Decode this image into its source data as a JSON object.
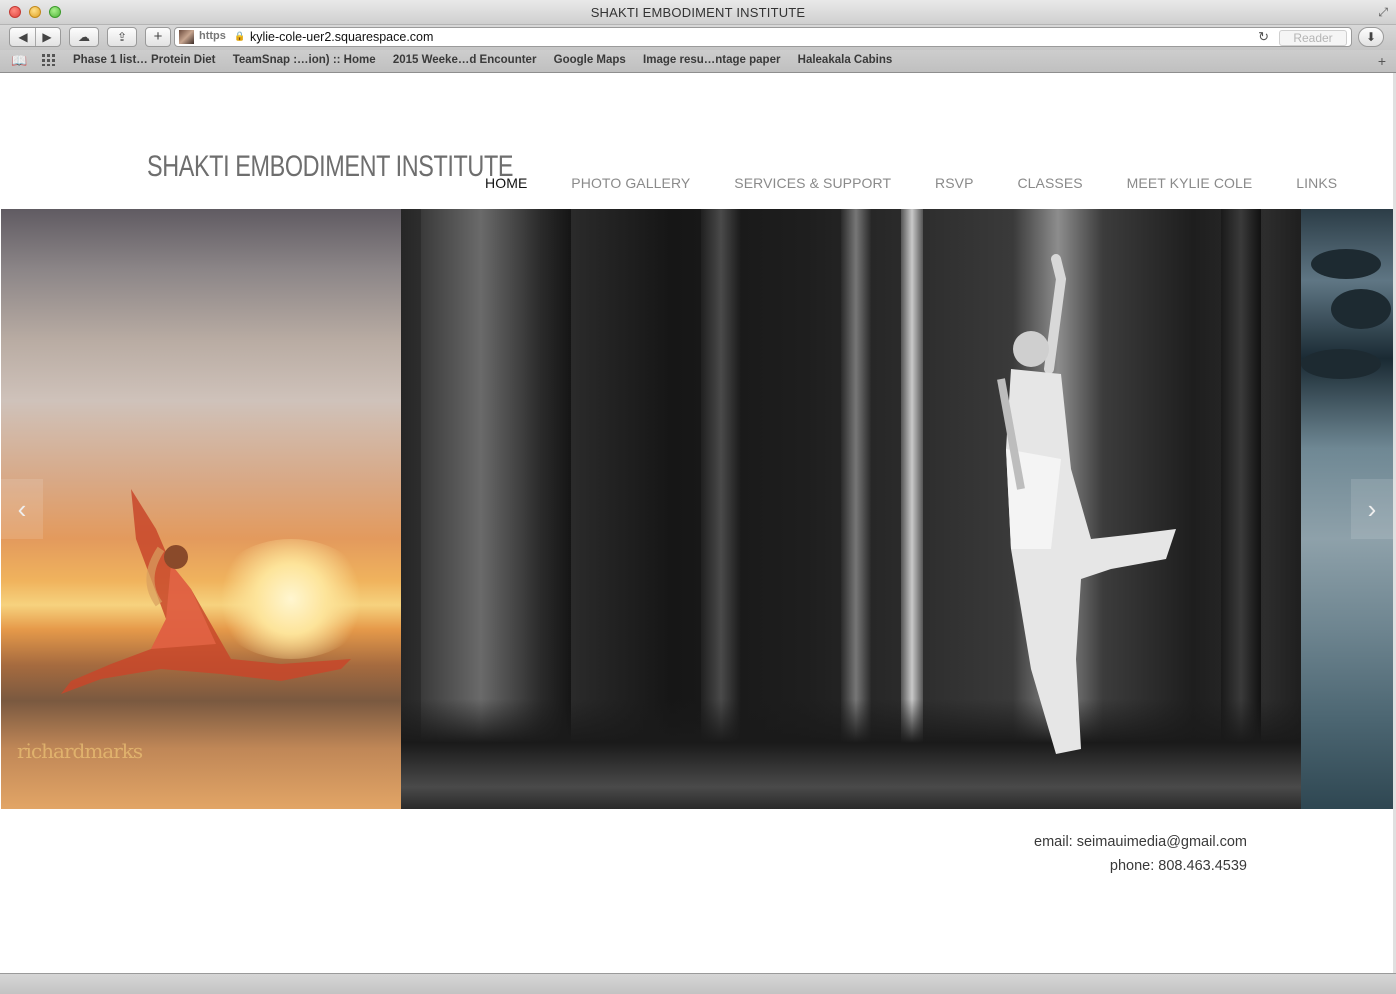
{
  "window": {
    "title": "SHAKTI EMBODIMENT INSTITUTE"
  },
  "toolbar": {
    "back_glyph": "◀",
    "forward_glyph": "▶",
    "icloud_glyph": "☁",
    "share_glyph": "⇪",
    "new_tab_glyph": "+",
    "url_scheme": "https",
    "url": "kylie-cole-uer2.squarespace.com",
    "reload_glyph": "↻",
    "reader_label": "Reader",
    "download_glyph": "⬇"
  },
  "bookmarks": {
    "items": [
      "Phase 1 list… Protein Diet",
      "TeamSnap :…ion) :: Home",
      "2015 Weeke…d Encounter",
      "Google Maps",
      "Image resu…ntage paper",
      "Haleakala Cabins"
    ],
    "add_glyph": "+"
  },
  "site": {
    "logo": "SHAKTI EMBODIMENT INSTITUTE",
    "nav": [
      {
        "label": "HOME",
        "active": true
      },
      {
        "label": "PHOTO GALLERY",
        "active": false
      },
      {
        "label": "SERVICES & SUPPORT",
        "active": false
      },
      {
        "label": "RSVP",
        "active": false
      },
      {
        "label": "CLASSES",
        "active": false
      },
      {
        "label": "MEET KYLIE COLE",
        "active": false
      },
      {
        "label": "LINKS",
        "active": false
      }
    ],
    "slideshow": {
      "prev_glyph": "‹",
      "next_glyph": "›",
      "watermark": "richardmarks"
    },
    "contact": {
      "email_line": "email: seimauimedia@gmail.com",
      "phone_line": "phone: 808.463.4539"
    }
  },
  "colors": {
    "nav_active": "#111111",
    "nav_inactive": "#8a8a8a",
    "logo": "#6e6e6e"
  }
}
